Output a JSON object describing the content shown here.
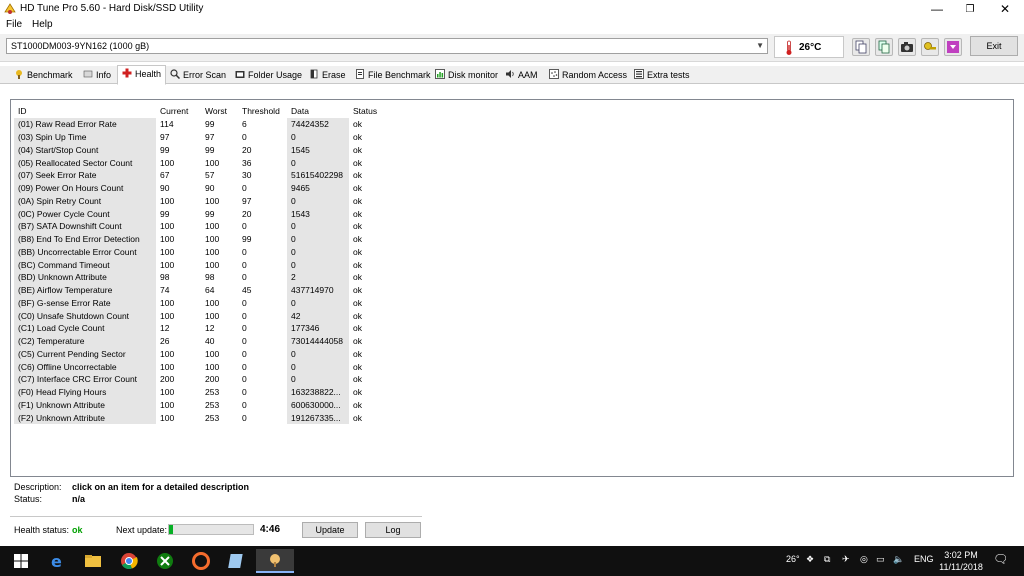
{
  "window": {
    "title": "HD Tune Pro 5.60 - Hard Disk/SSD Utility",
    "minimize": "—",
    "maximize": "❐",
    "close": "✕"
  },
  "menu": {
    "file": "File",
    "help": "Help"
  },
  "toolbar": {
    "drive": "ST1000DM003-9YN162 (1000 gB)",
    "temperature": "26°C",
    "exit_label": "Exit",
    "icons": [
      "copy-text-icon",
      "copy-info-icon",
      "screenshot-icon",
      "options-icon",
      "save-icon"
    ]
  },
  "tabs": [
    {
      "label": "Benchmark",
      "icon": "benchmark-icon"
    },
    {
      "label": "Info",
      "icon": "info-icon"
    },
    {
      "label": "Health",
      "icon": "health-cross-icon",
      "active": true
    },
    {
      "label": "Error Scan",
      "icon": "magnifier-icon"
    },
    {
      "label": "Folder Usage",
      "icon": "folder-icon"
    },
    {
      "label": "Erase",
      "icon": "eraser-icon"
    },
    {
      "label": "File Benchmark",
      "icon": "file-icon"
    },
    {
      "label": "Disk monitor",
      "icon": "monitor-chart-icon"
    },
    {
      "label": "AAM",
      "icon": "speaker-icon"
    },
    {
      "label": "Random Access",
      "icon": "random-access-icon"
    },
    {
      "label": "Extra tests",
      "icon": "extra-tests-icon"
    }
  ],
  "health": {
    "columns": [
      "ID",
      "Current",
      "Worst",
      "Threshold",
      "Data",
      "Status"
    ],
    "rows": [
      [
        "(01) Raw Read Error Rate",
        "114",
        "99",
        "6",
        "74424352",
        "ok"
      ],
      [
        "(03) Spin Up Time",
        "97",
        "97",
        "0",
        "0",
        "ok"
      ],
      [
        "(04) Start/Stop Count",
        "99",
        "99",
        "20",
        "1545",
        "ok"
      ],
      [
        "(05) Reallocated Sector Count",
        "100",
        "100",
        "36",
        "0",
        "ok"
      ],
      [
        "(07) Seek Error Rate",
        "67",
        "57",
        "30",
        "51615402298",
        "ok"
      ],
      [
        "(09) Power On Hours Count",
        "90",
        "90",
        "0",
        "9465",
        "ok"
      ],
      [
        "(0A) Spin Retry Count",
        "100",
        "100",
        "97",
        "0",
        "ok"
      ],
      [
        "(0C) Power Cycle Count",
        "99",
        "99",
        "20",
        "1543",
        "ok"
      ],
      [
        "(B7) SATA Downshift Count",
        "100",
        "100",
        "0",
        "0",
        "ok"
      ],
      [
        "(B8) End To End Error Detection",
        "100",
        "100",
        "99",
        "0",
        "ok"
      ],
      [
        "(BB) Uncorrectable Error Count",
        "100",
        "100",
        "0",
        "0",
        "ok"
      ],
      [
        "(BC) Command Timeout",
        "100",
        "100",
        "0",
        "0",
        "ok"
      ],
      [
        "(BD) Unknown Attribute",
        "98",
        "98",
        "0",
        "2",
        "ok"
      ],
      [
        "(BE) Airflow Temperature",
        "74",
        "64",
        "45",
        "437714970",
        "ok"
      ],
      [
        "(BF) G-sense Error Rate",
        "100",
        "100",
        "0",
        "0",
        "ok"
      ],
      [
        "(C0) Unsafe Shutdown Count",
        "100",
        "100",
        "0",
        "42",
        "ok"
      ],
      [
        "(C1) Load Cycle Count",
        "12",
        "12",
        "0",
        "177346",
        "ok"
      ],
      [
        "(C2) Temperature",
        "26",
        "40",
        "0",
        "73014444058",
        "ok"
      ],
      [
        "(C5) Current Pending Sector",
        "100",
        "100",
        "0",
        "0",
        "ok"
      ],
      [
        "(C6) Offline Uncorrectable",
        "100",
        "100",
        "0",
        "0",
        "ok"
      ],
      [
        "(C7) Interface CRC Error Count",
        "200",
        "200",
        "0",
        "0",
        "ok"
      ],
      [
        "(F0) Head Flying Hours",
        "100",
        "253",
        "0",
        "163238822...",
        "ok"
      ],
      [
        "(F1) Unknown Attribute",
        "100",
        "253",
        "0",
        "600630000...",
        "ok"
      ],
      [
        "(F2) Unknown Attribute",
        "100",
        "253",
        "0",
        "191267335...",
        "ok"
      ]
    ]
  },
  "details": {
    "description_label": "Description:",
    "description_value": "click on an item for a detailed description",
    "status_label": "Status:",
    "status_value": "n/a"
  },
  "footer": {
    "health_label": "Health status:",
    "health_value": "ok",
    "next_update_label": "Next update:",
    "progress": 0.05,
    "countdown": "4:46",
    "update_label": "Update",
    "log_label": "Log",
    "ok_color": "#00a000",
    "progress_color": "#06b025"
  },
  "taskbar": {
    "apps": [
      "windows-start-icon",
      "edge-icon",
      "file-explorer-icon",
      "chrome-icon",
      "xbox-icon",
      "origin-icon",
      "notepad-icon",
      "hdtune-icon"
    ],
    "weather": "26°",
    "language": "ENG",
    "time": "3:02 PM",
    "date": "11/11/2018"
  }
}
